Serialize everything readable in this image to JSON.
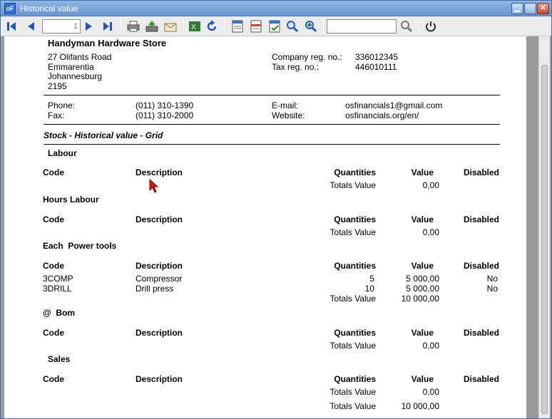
{
  "window": {
    "title": "Historical value",
    "app_icon": "oF"
  },
  "toolbar": {
    "page_number": "1",
    "search_value": ""
  },
  "report": {
    "company": "Handyman Hardware Store",
    "address": [
      "27 Olifants Road",
      "Emmarentia",
      "Johannesburg",
      "2195"
    ],
    "company_reg_label": "Company reg. no.:",
    "company_reg_value": "336012345",
    "tax_reg_label": "Tax reg. no.:",
    "tax_reg_value": "446010111",
    "phone_label": "Phone:",
    "phone_value": "(011) 310-1390",
    "fax_label": "Fax:",
    "fax_value": "(011) 310-2000",
    "email_label": "E-mail:",
    "email_value": "osfinancials1@gmail.com",
    "website_label": "Website:",
    "website_value": "osfinancials.org/en/",
    "report_title": "Stock - Historical value - Grid",
    "columns": {
      "code": "Code",
      "description": "Description",
      "quantities": "Quantities",
      "value": "Value",
      "disabled": "Disabled"
    },
    "totals_label": "Totals Value",
    "groups": [
      {
        "name": "Labour",
        "rows": [],
        "total": "0,00"
      },
      {
        "name": "Hours Labour",
        "rows": [],
        "total": "0,00"
      },
      {
        "name": "Each  Power tools",
        "rows": [
          {
            "code": "3COMP",
            "description": "Compressor",
            "quantity": "5",
            "value": "5 000,00",
            "disabled": "No"
          },
          {
            "code": "3DRILL",
            "description": "Drill press",
            "quantity": "10",
            "value": "5 000,00",
            "disabled": "No"
          }
        ],
        "total": "10 000,00"
      },
      {
        "name": "@  Bom",
        "rows": [],
        "total": "0,00"
      },
      {
        "name": "Sales",
        "rows": [],
        "total": "0,00"
      }
    ],
    "grand_total": "10 000,00"
  }
}
